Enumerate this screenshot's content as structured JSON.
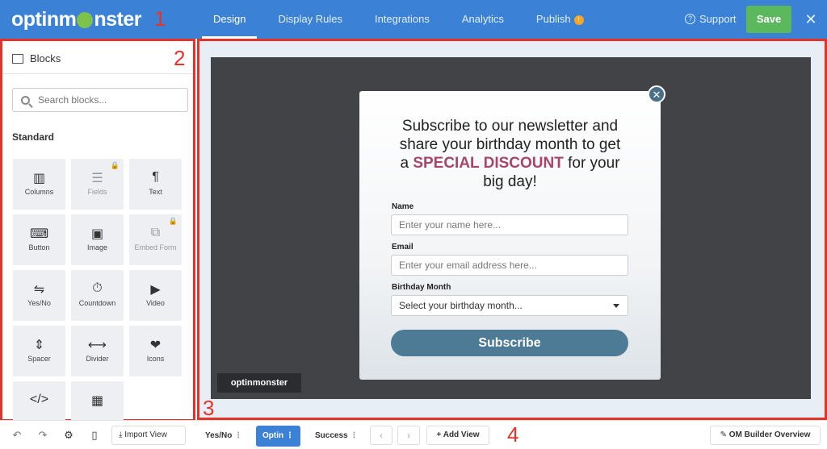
{
  "brand": {
    "logo_text_a": "optinm",
    "logo_text_b": "nster"
  },
  "annotations": {
    "one": "1",
    "two": "2",
    "three": "3",
    "four": "4"
  },
  "topnav": {
    "tabs": [
      {
        "label": "Design",
        "active": true
      },
      {
        "label": "Display Rules"
      },
      {
        "label": "Integrations"
      },
      {
        "label": "Analytics"
      },
      {
        "label": "Publish"
      }
    ],
    "publish_badge": "!",
    "support_label": "Support",
    "save_label": "Save",
    "close_glyph": "✕"
  },
  "sidebar": {
    "title": "Blocks",
    "search_placeholder": "Search blocks...",
    "section_label": "Standard",
    "blocks": [
      {
        "label": "Columns",
        "icon": "▥"
      },
      {
        "label": "Fields",
        "icon": "☰",
        "locked": true
      },
      {
        "label": "Text",
        "icon": "¶"
      },
      {
        "label": "Button",
        "icon": "⌨"
      },
      {
        "label": "Image",
        "icon": "▣"
      },
      {
        "label": "Embed Form",
        "icon": "⧉",
        "locked": true
      },
      {
        "label": "Yes/No",
        "icon": "⇋"
      },
      {
        "label": "Countdown",
        "icon": "⏱"
      },
      {
        "label": "Video",
        "icon": "▶"
      },
      {
        "label": "Spacer",
        "icon": "⇕"
      },
      {
        "label": "Divider",
        "icon": "⟷"
      },
      {
        "label": "Icons",
        "icon": "❤"
      },
      {
        "label": "",
        "icon": "</>"
      },
      {
        "label": "",
        "icon": "▦"
      }
    ]
  },
  "popup": {
    "headline_line1": "Subscribe to our newsletter and",
    "headline_line2": "share your birthday month to get",
    "headline_pre": "a",
    "headline_highlight": "SPECIAL DISCOUNT",
    "headline_post": "for your",
    "headline_line4": "big day!",
    "name_label": "Name",
    "name_placeholder": "Enter your name here...",
    "email_label": "Email",
    "email_placeholder": "Enter your email address here...",
    "month_label": "Birthday Month",
    "month_placeholder": "Select your birthday month...",
    "subscribe_label": "Subscribe",
    "close_glyph": "✕"
  },
  "canvas": {
    "badge_text": "optinmonster"
  },
  "bottombar": {
    "import_label": "Import View",
    "views": [
      {
        "label": "Yes/No"
      },
      {
        "label": "Optin",
        "active": true
      },
      {
        "label": "Success"
      }
    ],
    "add_view_label": "Add View",
    "overview_label": "OM Builder Overview"
  },
  "colors": {
    "topbar": "#3b82d6",
    "save": "#5cb85c",
    "annotation": "#e6332a",
    "highlight": "#a7466b",
    "subscribe": "#4d7b96"
  }
}
